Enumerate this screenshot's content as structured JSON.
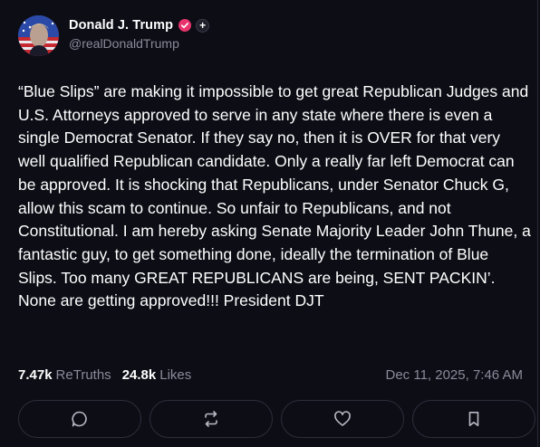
{
  "user": {
    "display_name": "Donald J. Trump",
    "handle": "@realDonaldTrump",
    "plus_badge": "+"
  },
  "post": {
    "text": "“Blue Slips” are making it impossible to get great Republican Judges and U.S. Attorneys approved to serve in any state where there is even a single Democrat Senator. If they say no, then it is OVER for that very well qualified Republican candidate. Only a really far left Democrat can be approved. It is shocking that Republicans, under Senator Chuck G, allow this scam to continue. So unfair to Republicans, and not Constitutional. I am hereby asking Senate Majority Leader John Thune, a fantastic guy, to get something done, ideally the termination of Blue Slips. Too many GREAT REPUBLICANS are being, SENT PACKIN’. None are getting approved!!! President DJT"
  },
  "stats": {
    "retruths_count": "7.47k",
    "retruths_label": "ReTruths",
    "likes_count": "24.8k",
    "likes_label": "Likes",
    "timestamp": "Dec 11, 2025, 7:46 AM"
  },
  "actions": [
    {
      "icon": "reply-icon"
    },
    {
      "icon": "retruth-icon"
    },
    {
      "icon": "like-icon"
    },
    {
      "icon": "bookmark-icon"
    }
  ],
  "colors": {
    "background": "#0d0d16",
    "text": "#ffffff",
    "muted": "#8a8a9a",
    "verified": "#e8336d",
    "border": "#2e2e3c"
  }
}
